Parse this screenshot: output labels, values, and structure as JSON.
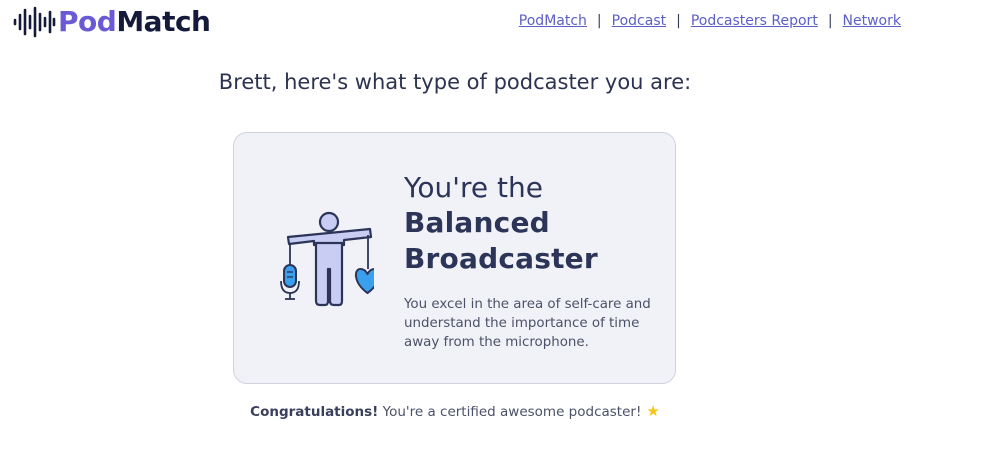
{
  "header": {
    "logo": {
      "part1": "Pod",
      "part2": "Match"
    },
    "nav": [
      {
        "label": "PodMatch"
      },
      {
        "label": "Podcast"
      },
      {
        "label": "Podcasters Report"
      },
      {
        "label": "Network"
      }
    ],
    "separator": "|"
  },
  "main": {
    "headline": "Brett, here's what type of podcaster you are:",
    "card": {
      "lead": "You're the",
      "type_line1": "Balanced",
      "type_line2": "Broadcaster",
      "description": "You excel in the area of self-care and understand the importance of time away from the microphone."
    },
    "congrats": {
      "bold": "Congratulations!",
      "text": " You're a certified awesome podcaster!",
      "icon": "star-icon"
    }
  },
  "colors": {
    "brand_purple": "#6a5ad6",
    "brand_dark": "#151a3a",
    "link": "#5b5fc7",
    "heading": "#2c3558",
    "card_bg": "#f1f2f7",
    "heart_blue": "#3aa0ee",
    "figure_fill": "#c9cdf3",
    "star": "#f5c518"
  }
}
